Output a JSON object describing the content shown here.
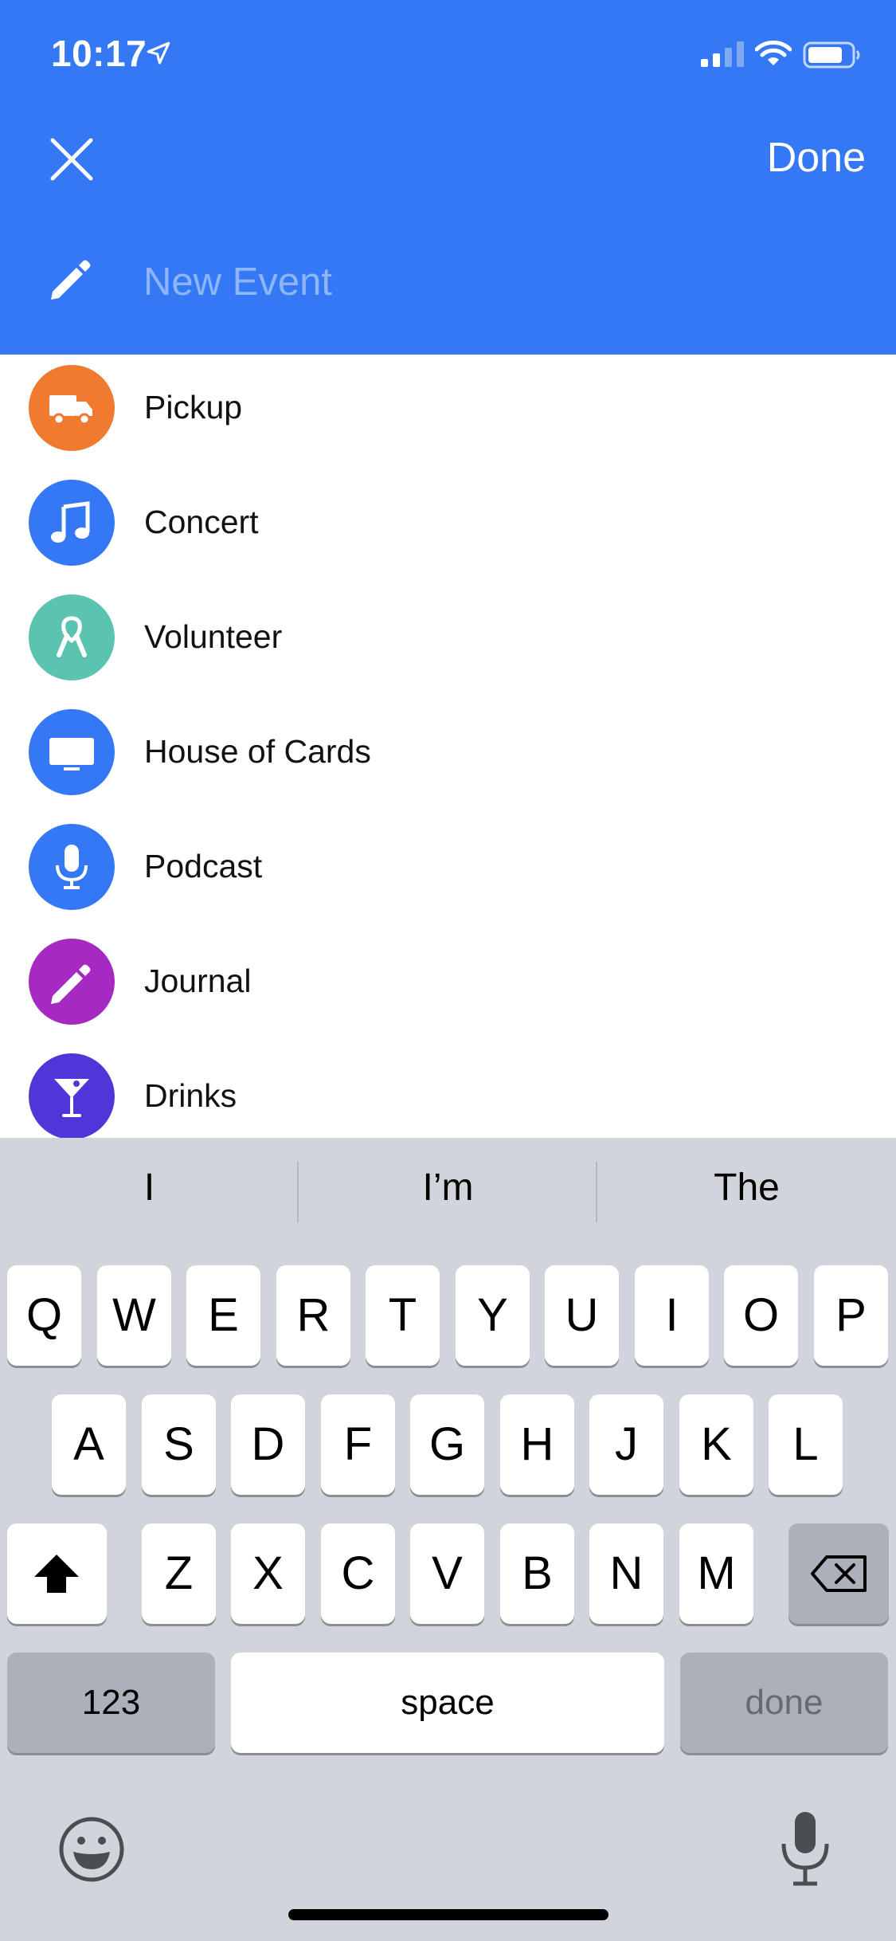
{
  "status_bar": {
    "time": "10:17",
    "icons": [
      "location-arrow-icon",
      "cellular-signal-icon",
      "wifi-icon",
      "battery-icon"
    ]
  },
  "header": {
    "background_color": "#3478F6",
    "close_icon": "close-icon",
    "done_label": "Done",
    "title_placeholder": "New Event",
    "title_value": ""
  },
  "suggestions": [
    {
      "label": "Pickup",
      "icon": "truck-icon",
      "color": "#F07A30"
    },
    {
      "label": "Concert",
      "icon": "music-note-icon",
      "color": "#3478F6"
    },
    {
      "label": "Volunteer",
      "icon": "ribbon-icon",
      "color": "#5BC4B0"
    },
    {
      "label": "House of Cards",
      "icon": "tv-icon",
      "color": "#3478F6"
    },
    {
      "label": "Podcast",
      "icon": "microphone-icon",
      "color": "#3478F6"
    },
    {
      "label": "Journal",
      "icon": "pencil-icon",
      "color": "#A629C2"
    },
    {
      "label": "Drinks",
      "icon": "cocktail-icon",
      "color": "#5036D6"
    }
  ],
  "keyboard": {
    "predictions": [
      "I",
      "I’m",
      "The"
    ],
    "row1": [
      "Q",
      "W",
      "E",
      "R",
      "T",
      "Y",
      "U",
      "I",
      "O",
      "P"
    ],
    "row2": [
      "A",
      "S",
      "D",
      "F",
      "G",
      "H",
      "J",
      "K",
      "L"
    ],
    "row3": [
      "Z",
      "X",
      "C",
      "V",
      "B",
      "N",
      "M"
    ],
    "numbers_label": "123",
    "space_label": "space",
    "done_label": "done",
    "shift_icon": "shift-icon",
    "backspace_icon": "backspace-icon",
    "emoji_icon": "emoji-icon",
    "dictation_icon": "microphone-icon"
  }
}
